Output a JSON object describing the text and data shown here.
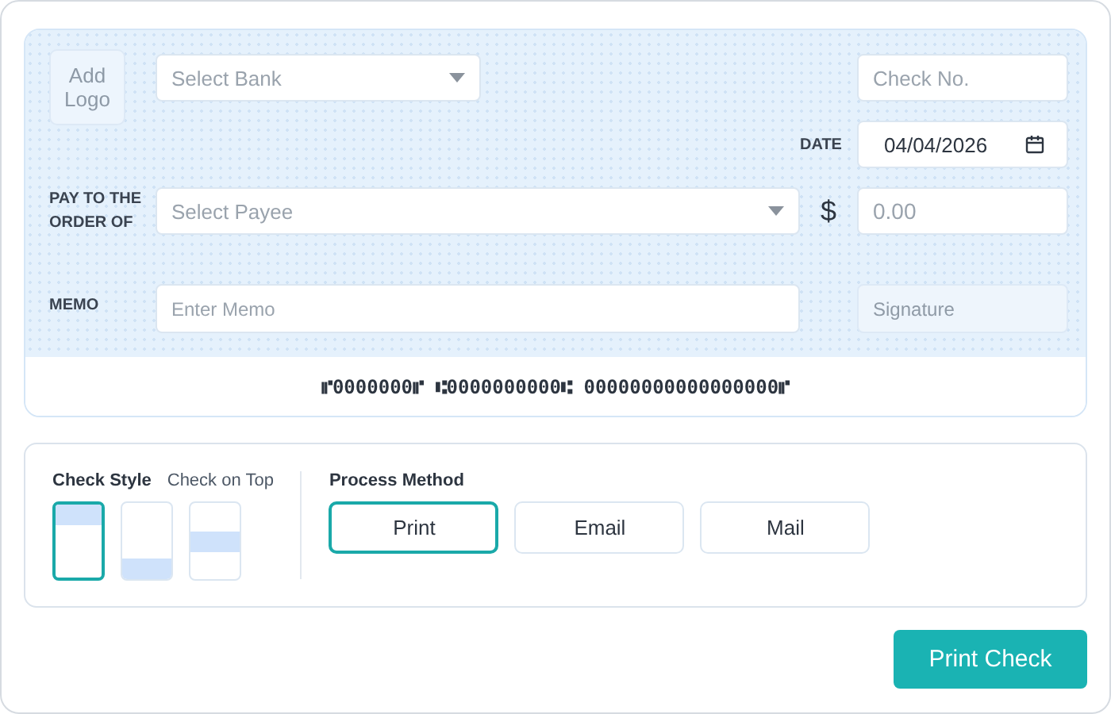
{
  "check": {
    "logo_button": "Add Logo",
    "bank_select": {
      "placeholder": "Select Bank"
    },
    "check_number": {
      "placeholder": "Check No."
    },
    "date": {
      "label": "DATE",
      "value": "04/04/2026"
    },
    "payee": {
      "label": "PAY TO THE ORDER OF",
      "placeholder": "Select Payee"
    },
    "currency": "$",
    "amount": {
      "placeholder": "0.00"
    },
    "memo": {
      "label": "MEMO",
      "placeholder": "Enter Memo"
    },
    "signature": {
      "placeholder": "Signature",
      "disabled": true
    },
    "micr_line": "⑈0000000⑈ ⑆0000000000⑆ 00000000000000000⑈"
  },
  "check_style": {
    "label": "Check Style",
    "selected_name": "Check on Top",
    "options": [
      {
        "kind": "top",
        "selected": true
      },
      {
        "kind": "bottom",
        "selected": false
      },
      {
        "kind": "middle",
        "selected": false
      }
    ]
  },
  "process_method": {
    "label": "Process Method",
    "options": [
      {
        "label": "Print",
        "selected": true
      },
      {
        "label": "Email",
        "selected": false
      },
      {
        "label": "Mail",
        "selected": false
      }
    ]
  },
  "print_button": "Print Check"
}
